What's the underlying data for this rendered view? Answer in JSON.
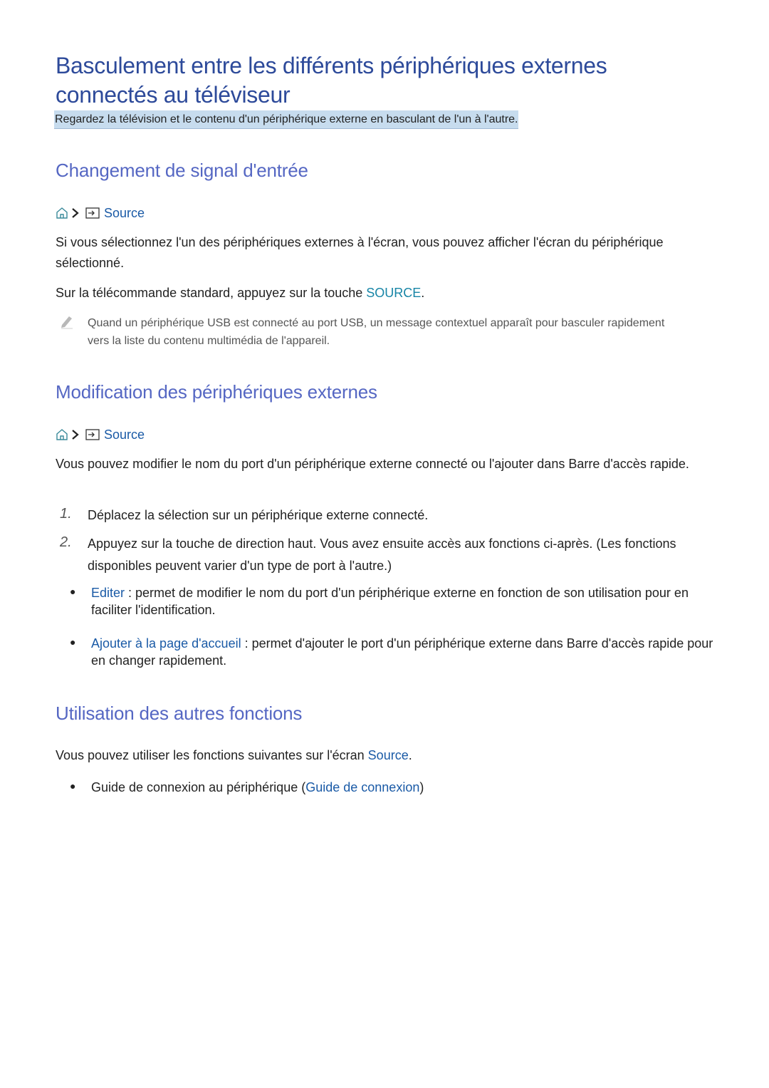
{
  "page": {
    "title": "Basculement entre les différents périphériques externes connectés au téléviseur",
    "subtitle": "Regardez la télévision et le contenu d'un périphérique externe en basculant de l'un à l'autre."
  },
  "sections": [
    {
      "heading": "Changement de signal d'entrée",
      "path": {
        "home_icon": "home-icon",
        "separator_icon": "chevron-right-icon",
        "source_icon": "source-input-icon",
        "link": "Source"
      },
      "paragraph": "Si vous sélectionnez l'un des périphériques externes à l'écran, vous pouvez afficher l'écran du périphérique sélectionné.",
      "remote_text_prefix": "Sur la télécommande standard, appuyez sur la touche ",
      "remote_key": "SOURCE",
      "remote_text_suffix": ".",
      "note": "Quand un périphérique USB est connecté au port USB, un message contextuel apparaît pour basculer rapidement vers la liste du contenu multimédia de l'appareil."
    },
    {
      "heading": "Modification des périphériques externes",
      "path": {
        "home_icon": "home-icon",
        "separator_icon": "chevron-right-icon",
        "source_icon": "source-input-icon",
        "link": "Source"
      },
      "paragraph": "Vous pouvez modifier le nom du port d'un périphérique externe connecté ou l'ajouter dans Barre d'accès rapide.",
      "steps": [
        {
          "number": "1.",
          "text": "Déplacez la sélection sur un périphérique externe connecté."
        },
        {
          "number": "2.",
          "text": "Appuyez sur la touche de direction haut. Vous avez ensuite accès aux fonctions ci-après. (Les fonctions disponibles peuvent varier d'un type de port à l'autre.)"
        }
      ],
      "bullets": [
        {
          "label": "Editer",
          "text": " : permet de modifier le nom du port d'un périphérique externe en fonction de son utilisation pour en faciliter l'identification."
        },
        {
          "label": "Ajouter à la page d'accueil",
          "text": " : permet d'ajouter le port d'un périphérique externe dans Barre d'accès rapide pour en changer rapidement."
        }
      ]
    },
    {
      "heading": "Utilisation des autres fonctions",
      "paragraph_prefix": "Vous pouvez utiliser les fonctions suivantes sur l'écran ",
      "paragraph_link": "Source",
      "paragraph_suffix": ".",
      "bullets": [
        {
          "text": "Guide de connexion au périphérique (",
          "link": "Guide de connexion",
          "suffix": ")"
        }
      ]
    }
  ],
  "colors": {
    "title": "#2d4a9a",
    "heading": "#5567c3",
    "link": "#1a5aa6",
    "key": "#1785a6",
    "subtitle_highlight": "#c7dcee"
  }
}
